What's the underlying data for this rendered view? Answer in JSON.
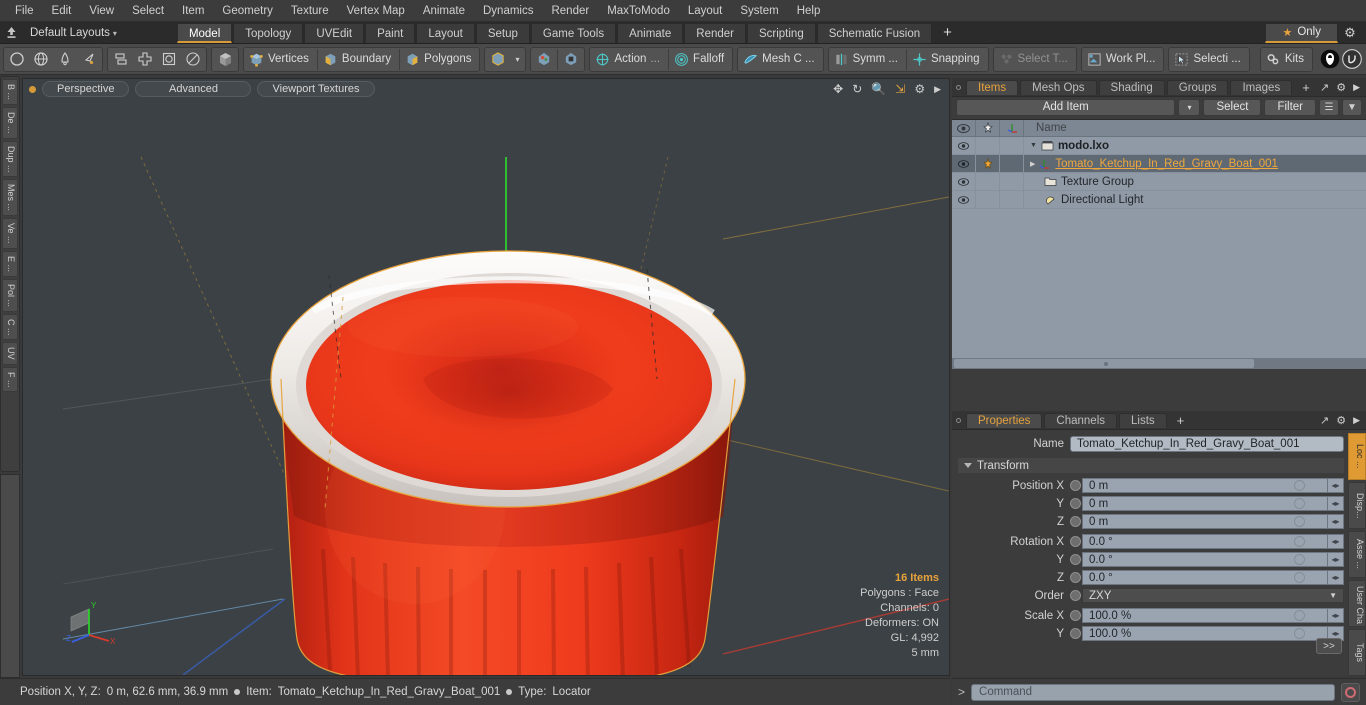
{
  "menu": {
    "items": [
      "File",
      "Edit",
      "View",
      "Select",
      "Item",
      "Geometry",
      "Texture",
      "Vertex Map",
      "Animate",
      "Dynamics",
      "Render",
      "MaxToModo",
      "Layout",
      "System",
      "Help"
    ]
  },
  "layout_bar": {
    "title": "Default Layouts",
    "caret": "▾",
    "home_icon": "home-arrow-icon",
    "tabs": [
      {
        "label": "Model",
        "active": true
      },
      {
        "label": "Topology",
        "active": false
      },
      {
        "label": "UVEdit",
        "active": false
      },
      {
        "label": "Paint",
        "active": false
      },
      {
        "label": "Layout",
        "active": false
      },
      {
        "label": "Setup",
        "active": false
      },
      {
        "label": "Game Tools",
        "active": false
      },
      {
        "label": "Animate",
        "active": false
      },
      {
        "label": "Render",
        "active": false
      },
      {
        "label": "Scripting",
        "active": false
      },
      {
        "label": "Schematic Fusion",
        "active": false
      }
    ],
    "add_tab": "+",
    "only_label": "Only",
    "star_icon": "star-icon",
    "gear_icon": "gear-icon"
  },
  "toolbar": {
    "group1": [
      "circle-icon",
      "globe-icon",
      "pen-icon",
      "lasso-icon"
    ],
    "group2": [
      "align-icon",
      "cross-icon",
      "square-outline-icon",
      "ellipse-icon"
    ],
    "group3": [
      "cube-shade-icon"
    ],
    "selection_modes": [
      {
        "label": "Vertices",
        "icon": "vertices-icon"
      },
      {
        "label": "Boundary",
        "icon": "boundary-icon"
      },
      {
        "label": "Polygons",
        "icon": "polygons-icon"
      }
    ],
    "item_mode_icon": "item-cube-icon",
    "item_mode_caret": "▾",
    "center_icon": "center-pivot-icon",
    "pivot_icon": "pivot-icon",
    "action_label": "Action",
    "action_ellipsis": "...",
    "falloff_label": "Falloff",
    "mesh_constraint_label": "Mesh C ...",
    "symmetry_label": "Symm ...",
    "snapping_label": "Snapping",
    "select_through_label": "Select T...",
    "work_plane_label": "Work Pl...",
    "selection_label": "Selecti ...",
    "kits_label": "Kits",
    "black_sphere_icon": "modo-badge-icon",
    "unreal_icon": "unreal-badge-icon"
  },
  "left_tabs": [
    "B ...",
    "De ...",
    "Dup ...",
    "Mes ...",
    "Ve ...",
    "E ...",
    "Pol ...",
    "C ...",
    "UV",
    "F ..."
  ],
  "viewport": {
    "dot": "active-viewport-dot",
    "pills": [
      "Perspective",
      "Advanced",
      "Viewport Textures"
    ],
    "tools": [
      "move-icon",
      "rotate-icon",
      "zoom-icon",
      "fit-icon",
      "gear-icon",
      "arrow-icon"
    ],
    "info": {
      "items": "16 Items",
      "polygons": "Polygons : Face",
      "channels": "Channels: 0",
      "deformers": "Deformers: ON",
      "gl": "GL: 4,992",
      "scale": "5 mm"
    },
    "axis_labels": {
      "x": "X",
      "y": "Y",
      "z": "Z"
    }
  },
  "items_panel": {
    "tabs": [
      {
        "label": "Items",
        "active": true
      },
      {
        "label": "Mesh Ops",
        "active": false
      },
      {
        "label": "Shading",
        "active": false
      },
      {
        "label": "Groups",
        "active": false
      },
      {
        "label": "Images",
        "active": false
      }
    ],
    "add_tab": "+",
    "expand_icon": "expand-icon",
    "gear_icon": "gear-icon",
    "arrow_icon": "chevron-right-icon",
    "add_item_label": "Add Item",
    "add_item_caret": "▾",
    "select_label": "Select",
    "filter_label": "Filter",
    "list_columns": {
      "eye": "visibility-icon",
      "lock": "transform-icon",
      "axis": "axis-icon",
      "name": "Name"
    },
    "rows": [
      {
        "name": "modo.lxo",
        "icon": "scene-icon",
        "indent": 0,
        "selected": false,
        "bold": true,
        "orange": false,
        "expander": "▼",
        "has_xf": false
      },
      {
        "name": "Tomato_Ketchup_In_Red_Gravy_Boat_001",
        "icon": "locator-icon",
        "indent": 1,
        "selected": true,
        "bold": false,
        "orange": true,
        "expander": "▶",
        "has_xf": true
      },
      {
        "name": "Texture Group",
        "icon": "folder-icon",
        "indent": 1,
        "selected": false,
        "bold": false,
        "orange": false,
        "expander": "",
        "has_xf": false
      },
      {
        "name": "Directional Light",
        "icon": "light-icon",
        "indent": 1,
        "selected": false,
        "bold": false,
        "orange": false,
        "expander": "",
        "has_xf": false
      }
    ]
  },
  "properties_panel": {
    "tabs": [
      {
        "label": "Properties",
        "active": true
      },
      {
        "label": "Channels",
        "active": false
      },
      {
        "label": "Lists",
        "active": false
      }
    ],
    "add_tab": "+",
    "name_label": "Name",
    "name_value": "Tomato_Ketchup_In_Red_Gravy_Boat_001",
    "transform_header": "Transform",
    "fields": [
      {
        "label": "Position X",
        "value": "0 m",
        "type": "spin"
      },
      {
        "label": "Y",
        "value": "0 m",
        "type": "spin"
      },
      {
        "label": "Z",
        "value": "0 m",
        "type": "spin"
      },
      {
        "label": "Rotation X",
        "value": "0.0 °",
        "type": "spin"
      },
      {
        "label": "Y",
        "value": "0.0 °",
        "type": "spin"
      },
      {
        "label": "Z",
        "value": "0.0 °",
        "type": "spin"
      },
      {
        "label": "Order",
        "value": "ZXY",
        "type": "select"
      },
      {
        "label": "Scale X",
        "value": "100.0 %",
        "type": "spin"
      },
      {
        "label": "Y",
        "value": "100.0 %",
        "type": "spin"
      }
    ],
    "more_button": ">>",
    "side_tabs": [
      {
        "label": "Loc ...",
        "active": true
      },
      {
        "label": "Disp...",
        "active": false
      },
      {
        "label": "Asse ...",
        "active": false
      },
      {
        "label": "User Cha ...",
        "active": false
      },
      {
        "label": "Tags",
        "active": false
      }
    ]
  },
  "status_bar": {
    "position_label": "Position X, Y, Z:",
    "position_value": "0 m, 62.6 mm, 36.9 mm",
    "item_label": "Item:",
    "item_value": "Tomato_Ketchup_In_Red_Gravy_Boat_001",
    "type_label": "Type:",
    "type_value": "Locator"
  },
  "command_bar": {
    "prompt": ">",
    "placeholder": "Command",
    "record_icon": "record-icon"
  },
  "colors": {
    "accent_orange": "#e8a33d",
    "selection_orange": "#f0a73c",
    "panel_bg": "#3c3c3c",
    "toolbar_bg": "#4a4a4a",
    "list_bg": "#909aa6",
    "viewport_bg": "#3b4144",
    "model_red": "#e8341c",
    "model_white": "#f2f0ee"
  }
}
